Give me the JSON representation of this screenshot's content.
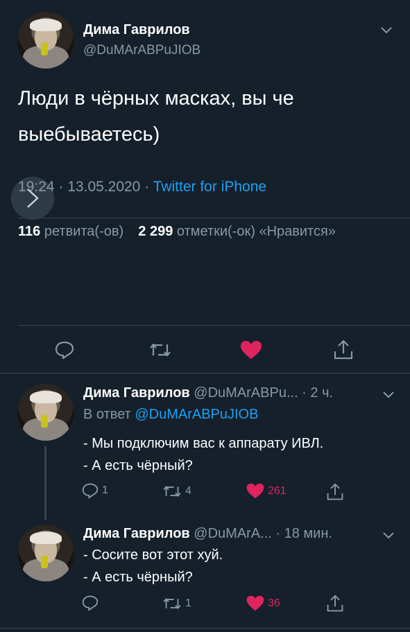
{
  "main_tweet": {
    "display_name": "Дима Гаврилов",
    "handle": "@DuMArABPuJIOB",
    "text_line1": "Люди в чёрных масках, вы че",
    "text_line2": "выебываетесь)",
    "time": "19:24",
    "date": "13.05.2020",
    "source": "Twitter for iPhone",
    "sep": "·",
    "retweets_count": "116",
    "retweets_label": "ретвита(-ов)",
    "likes_count": "2 299",
    "likes_label": "отметки(-ок) «Нравится»"
  },
  "replies": [
    {
      "display_name": "Дима Гаврилов",
      "handle_time": "@DuMArABPu... · 2 ч.",
      "reply_to_prefix": "В ответ",
      "reply_to_handle": "@DuMArABPuJIOB",
      "line1": "- Мы подключим вас к аппарату ИВЛ.",
      "line2": "- А есть чёрный?",
      "replies_count": "1",
      "retweets_count": "4",
      "likes_count": "261"
    },
    {
      "display_name": "Дима Гаврилов",
      "handle_time": "@DuMArA... · 18 мин.",
      "line1": "- Сосите вот этот хуй.",
      "line2": "- А есть чёрный?",
      "retweets_count": "1",
      "likes_count": "36"
    }
  ],
  "colors": {
    "background": "#15202b",
    "muted": "#8899a6",
    "link": "#1da1f2",
    "like": "#e0245e",
    "divider": "#38444d"
  }
}
